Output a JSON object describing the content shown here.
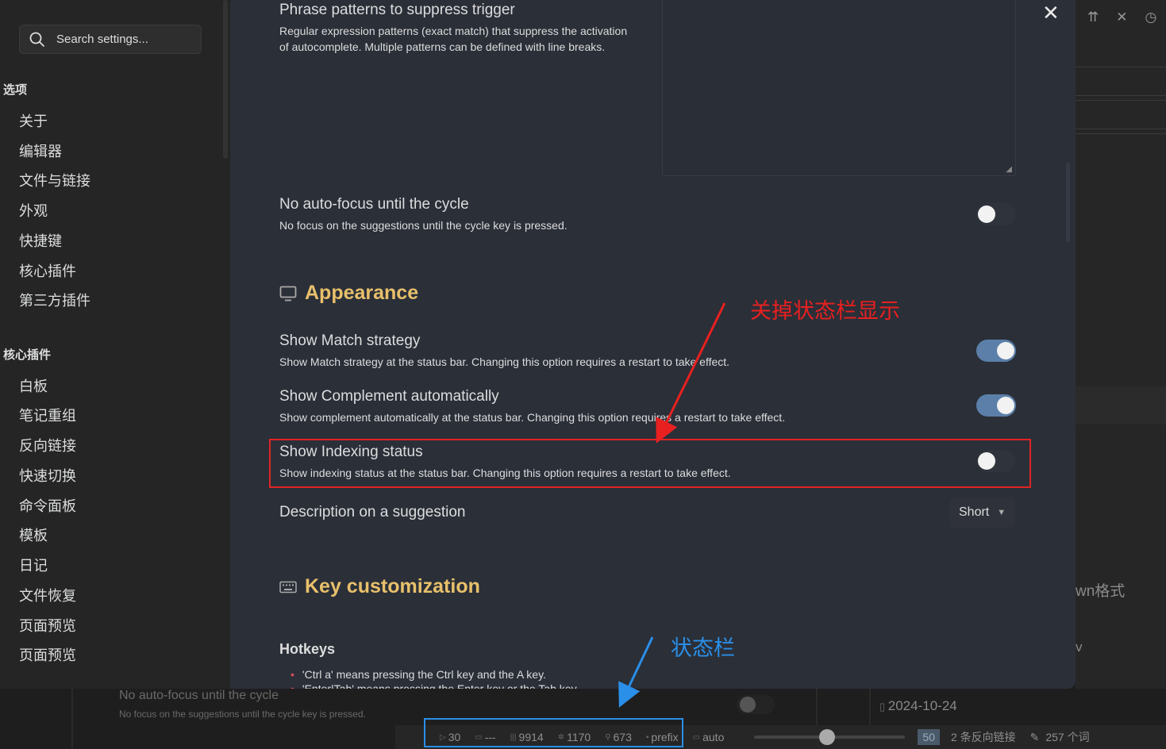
{
  "sidebar": {
    "search_placeholder": "Search settings...",
    "section_options": "选项",
    "options_items": [
      "关于",
      "编辑器",
      "文件与链接",
      "外观",
      "快捷键",
      "核心插件",
      "第三方插件"
    ],
    "section_core": "核心插件",
    "core_items": [
      "白板",
      "笔记重组",
      "反向链接",
      "快速切换",
      "命令面板",
      "模板",
      "日记",
      "文件恢复",
      "页面预览",
      "页面预览"
    ]
  },
  "settings": {
    "phrase_title": "Phrase patterns to suppress trigger",
    "phrase_desc": "Regular expression patterns (exact match) that suppress the activation of autocomplete. Multiple patterns can be defined with line breaks.",
    "noautofocus_title": "No auto-focus until the cycle",
    "noautofocus_desc": "No focus on the suggestions until the cycle key is pressed.",
    "appearance_heading": "Appearance",
    "match_title": "Show Match strategy",
    "match_desc": "Show Match strategy at the status bar. Changing this option requires a restart to take effect.",
    "complement_title": "Show Complement automatically",
    "complement_desc": "Show complement automatically at the status bar. Changing this option requires a restart to take effect.",
    "indexing_title": "Show Indexing status",
    "indexing_desc": "Show indexing status at the status bar. Changing this option requires a restart to take effect.",
    "description_title": "Description on a suggestion",
    "description_value": "Short",
    "key_heading": "Key customization",
    "hotkeys_heading": "Hotkeys",
    "hotkey_bullet_1": "'Ctrl a' means pressing the Ctrl key and the A key.",
    "hotkey_bullet_2": "'Enter|Tab' means pressing the Enter key or the Tab key."
  },
  "toggles": {
    "noautofocus": false,
    "match": true,
    "complement": true,
    "indexing": false
  },
  "background": {
    "ghost_title": "No auto-focus until the cycle",
    "ghost_desc": "No focus on the suggestions until the cycle key is pressed.",
    "date": "2024-10-24",
    "right_text": "wn格式",
    "right_v": "v"
  },
  "statusbar": {
    "s1": "30",
    "s2": "---",
    "s3": "9914",
    "s4": "1170",
    "s5": "673",
    "prefix": "prefix",
    "auto": "auto",
    "zoom": "50",
    "backlinks": "2 条反向链接",
    "words": "257 个词"
  },
  "annotations": {
    "red_text": "关掉状态栏显示",
    "blue_text": "状态栏"
  },
  "colors": {
    "heading_accent": "#e8c06b",
    "toggle_on": "#5b7fa8",
    "annotation_red": "#e02424",
    "annotation_blue": "#2a8fe8"
  }
}
